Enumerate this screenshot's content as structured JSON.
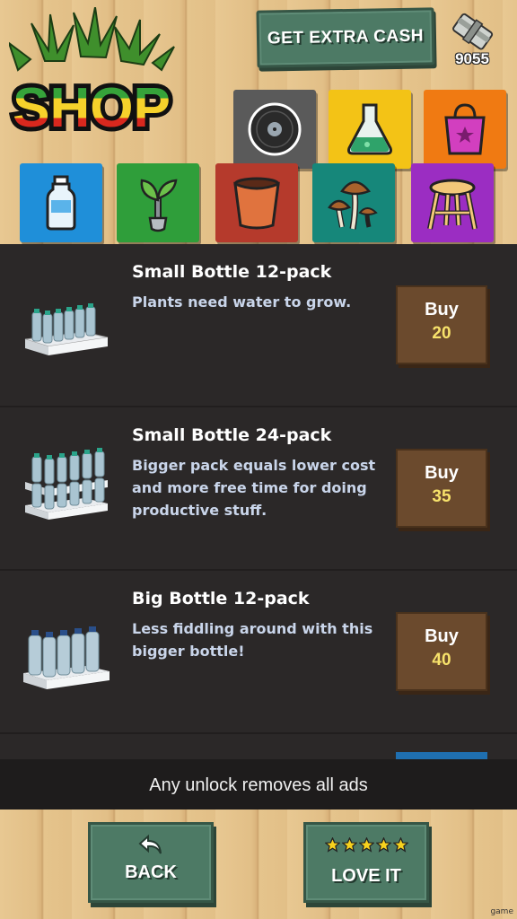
{
  "header": {
    "logo_text": "SHOP",
    "extra_cash_label": "GET EXTRA CASH",
    "cash_amount": "9055"
  },
  "categories": {
    "top": [
      {
        "name": "record",
        "color": "#5a5a5a"
      },
      {
        "name": "flask",
        "color": "#f3c316"
      },
      {
        "name": "shopping-bag",
        "color": "#f07a12"
      }
    ],
    "bottom": [
      {
        "name": "water-bottle",
        "color": "#1f8fd9",
        "selected": true
      },
      {
        "name": "shovel-plant",
        "color": "#2f9e3a"
      },
      {
        "name": "flower-pot",
        "color": "#b53a2c"
      },
      {
        "name": "mushrooms",
        "color": "#16877a"
      },
      {
        "name": "stool",
        "color": "#9b2dc2"
      }
    ]
  },
  "items": [
    {
      "title": "Small Bottle 12-pack",
      "desc": "Plants need water to grow.",
      "buy_label": "Buy",
      "price": "20"
    },
    {
      "title": "Small Bottle 24-pack",
      "desc": "Bigger pack equals lower cost and more free time for doing productive stuff.",
      "buy_label": "Buy",
      "price": "35"
    },
    {
      "title": "Big Bottle 12-pack",
      "desc": "Less fiddling around with this bigger bottle!",
      "buy_label": "Buy",
      "price": "40"
    }
  ],
  "ads_notice": "Any unlock removes all ads",
  "footer": {
    "back_label": "BACK",
    "love_label": "LOVE IT",
    "stars": 5
  },
  "watermark": "game"
}
